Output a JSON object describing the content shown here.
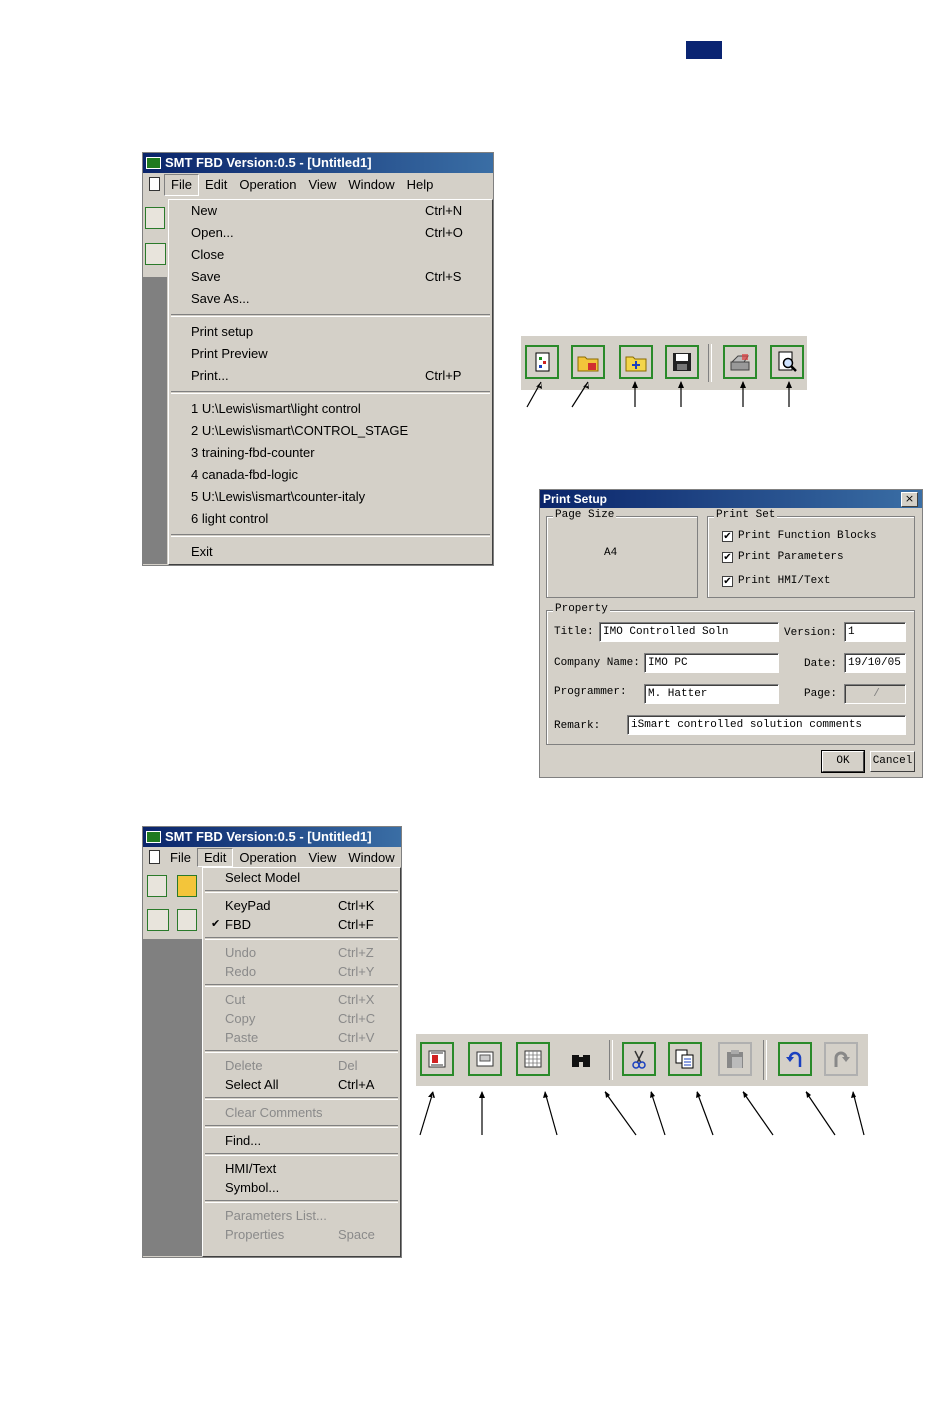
{
  "file_window": {
    "title": "SMT FBD Version:0.5 - [Untitled1]",
    "menubar": [
      "File",
      "Edit",
      "Operation",
      "View",
      "Window",
      "Help"
    ],
    "file_menu": {
      "group1": [
        {
          "label": "New",
          "shortcut": "Ctrl+N"
        },
        {
          "label": "Open...",
          "shortcut": "Ctrl+O"
        },
        {
          "label": "Close",
          "shortcut": ""
        },
        {
          "label": "Save",
          "shortcut": "Ctrl+S"
        },
        {
          "label": "Save As...",
          "shortcut": ""
        }
      ],
      "group2": [
        {
          "label": "Print setup",
          "shortcut": ""
        },
        {
          "label": "Print Preview",
          "shortcut": ""
        },
        {
          "label": "Print...",
          "shortcut": "Ctrl+P"
        }
      ],
      "recent": [
        "1 U:\\Lewis\\ismart\\light control",
        "2 U:\\Lewis\\ismart\\CONTROL_STAGE",
        "3 training-fbd-counter",
        "4 canada-fbd-logic",
        "5 U:\\Lewis\\ismart\\counter-italy",
        "6 light control"
      ],
      "exit": "Exit"
    }
  },
  "file_toolbar": {
    "icons": [
      "new-file-icon",
      "open-folder-icon",
      "open-project-icon",
      "save-disk-icon",
      "printer-icon",
      "print-preview-icon"
    ]
  },
  "print_setup": {
    "title": "Print Setup",
    "close": "×",
    "page_size_label": "Page Size",
    "page_size": "A4",
    "print_set_label": "Print Set",
    "print_set": [
      {
        "label": "Print Function Blocks",
        "checked": true
      },
      {
        "label": "Print Parameters",
        "checked": true
      },
      {
        "label": "Print HMI/Text",
        "checked": true
      }
    ],
    "property_label": "Property",
    "title_label": "Title:",
    "title_value": "IMO Controlled Soln",
    "version_label": "Version:",
    "version_value": "1",
    "company_label": "Company Name:",
    "company_value": "IMO PC",
    "date_label": "Date:",
    "date_value": "19/10/05",
    "programmer_label": "Programmer:",
    "programmer_value": "M. Hatter",
    "page_label": "Page:",
    "page_value": "/",
    "remark_label": "Remark:",
    "remark_value": "iSmart controlled solution comments",
    "ok": "OK",
    "cancel": "Cancel"
  },
  "edit_window": {
    "title": "SMT FBD Version:0.5 - [Untitled1]",
    "menubar": [
      "File",
      "Edit",
      "Operation",
      "View",
      "Window"
    ],
    "edit_menu": {
      "groups": [
        [
          {
            "label": "Select Model",
            "shortcut": "",
            "disabled": false,
            "checked": false
          }
        ],
        [
          {
            "label": "KeyPad",
            "shortcut": "Ctrl+K",
            "disabled": false,
            "checked": false
          },
          {
            "label": "FBD",
            "shortcut": "Ctrl+F",
            "disabled": false,
            "checked": true
          }
        ],
        [
          {
            "label": "Undo",
            "shortcut": "Ctrl+Z",
            "disabled": true,
            "checked": false
          },
          {
            "label": "Redo",
            "shortcut": "Ctrl+Y",
            "disabled": true,
            "checked": false
          }
        ],
        [
          {
            "label": "Cut",
            "shortcut": "Ctrl+X",
            "disabled": true,
            "checked": false
          },
          {
            "label": "Copy",
            "shortcut": "Ctrl+C",
            "disabled": true,
            "checked": false
          },
          {
            "label": "Paste",
            "shortcut": "Ctrl+V",
            "disabled": true,
            "checked": false
          }
        ],
        [
          {
            "label": "Delete",
            "shortcut": "Del",
            "disabled": true,
            "checked": false
          },
          {
            "label": "Select All",
            "shortcut": "Ctrl+A",
            "disabled": false,
            "checked": false
          }
        ],
        [
          {
            "label": "Clear Comments",
            "shortcut": "",
            "disabled": true,
            "checked": false
          }
        ],
        [
          {
            "label": "Find...",
            "shortcut": "",
            "disabled": false,
            "checked": false
          }
        ],
        [
          {
            "label": "HMI/Text",
            "shortcut": "",
            "disabled": false,
            "checked": false
          },
          {
            "label": "Symbol...",
            "shortcut": "",
            "disabled": false,
            "checked": false
          }
        ],
        [
          {
            "label": "Parameters List...",
            "shortcut": "",
            "disabled": true,
            "checked": false
          },
          {
            "label": "Properties",
            "shortcut": "Space",
            "disabled": true,
            "checked": false
          }
        ]
      ]
    }
  },
  "edit_toolbar": {
    "icons": [
      "select-model-icon",
      "keypad-icon",
      "fbd-grid-icon",
      "find-binoculars-icon",
      "cut-scissors-icon",
      "copy-icon",
      "paste-icon",
      "undo-icon",
      "redo-icon"
    ]
  }
}
